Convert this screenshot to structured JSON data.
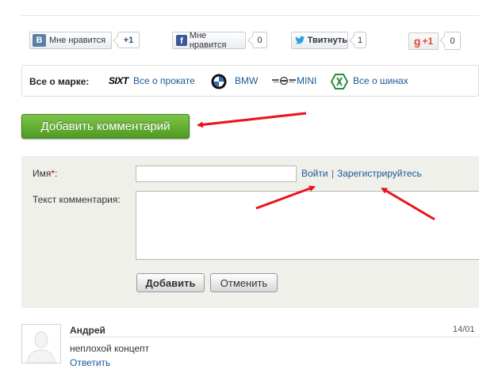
{
  "social": {
    "vk": {
      "badge": "В",
      "label": "Мне нравится",
      "count": "+1"
    },
    "facebook": {
      "badge": "f",
      "label": "Мне нравится",
      "count": "0"
    },
    "twitter": {
      "label": "Твитнуть",
      "count": "1"
    },
    "gplus": {
      "label": "+1",
      "count": "0"
    }
  },
  "brands": {
    "label": "Все о марке:",
    "sixt_logo": "SIXT",
    "rental": "Все о прокате",
    "bmw": "BMW",
    "mini": "MINI",
    "tyres": "Все о шинах"
  },
  "add_comment_label": "Добавить комментарий",
  "form": {
    "name_label": "Имя",
    "required_mark": "*",
    "colon": ":",
    "name_value": "",
    "login": "Войти",
    "separator": "|",
    "register": "Зарегистрируйтесь",
    "comment_label": "Текст комментария:",
    "comment_value": "",
    "submit": "Добавить",
    "cancel": "Отменить"
  },
  "comment": {
    "author": "Андрей",
    "date": "14/01",
    "text": "неплохой концепт",
    "reply": "Ответить"
  },
  "colors": {
    "accent_green": "#5aa82b",
    "link": "#1a5a96",
    "annotation_arrow": "#e8151b"
  }
}
